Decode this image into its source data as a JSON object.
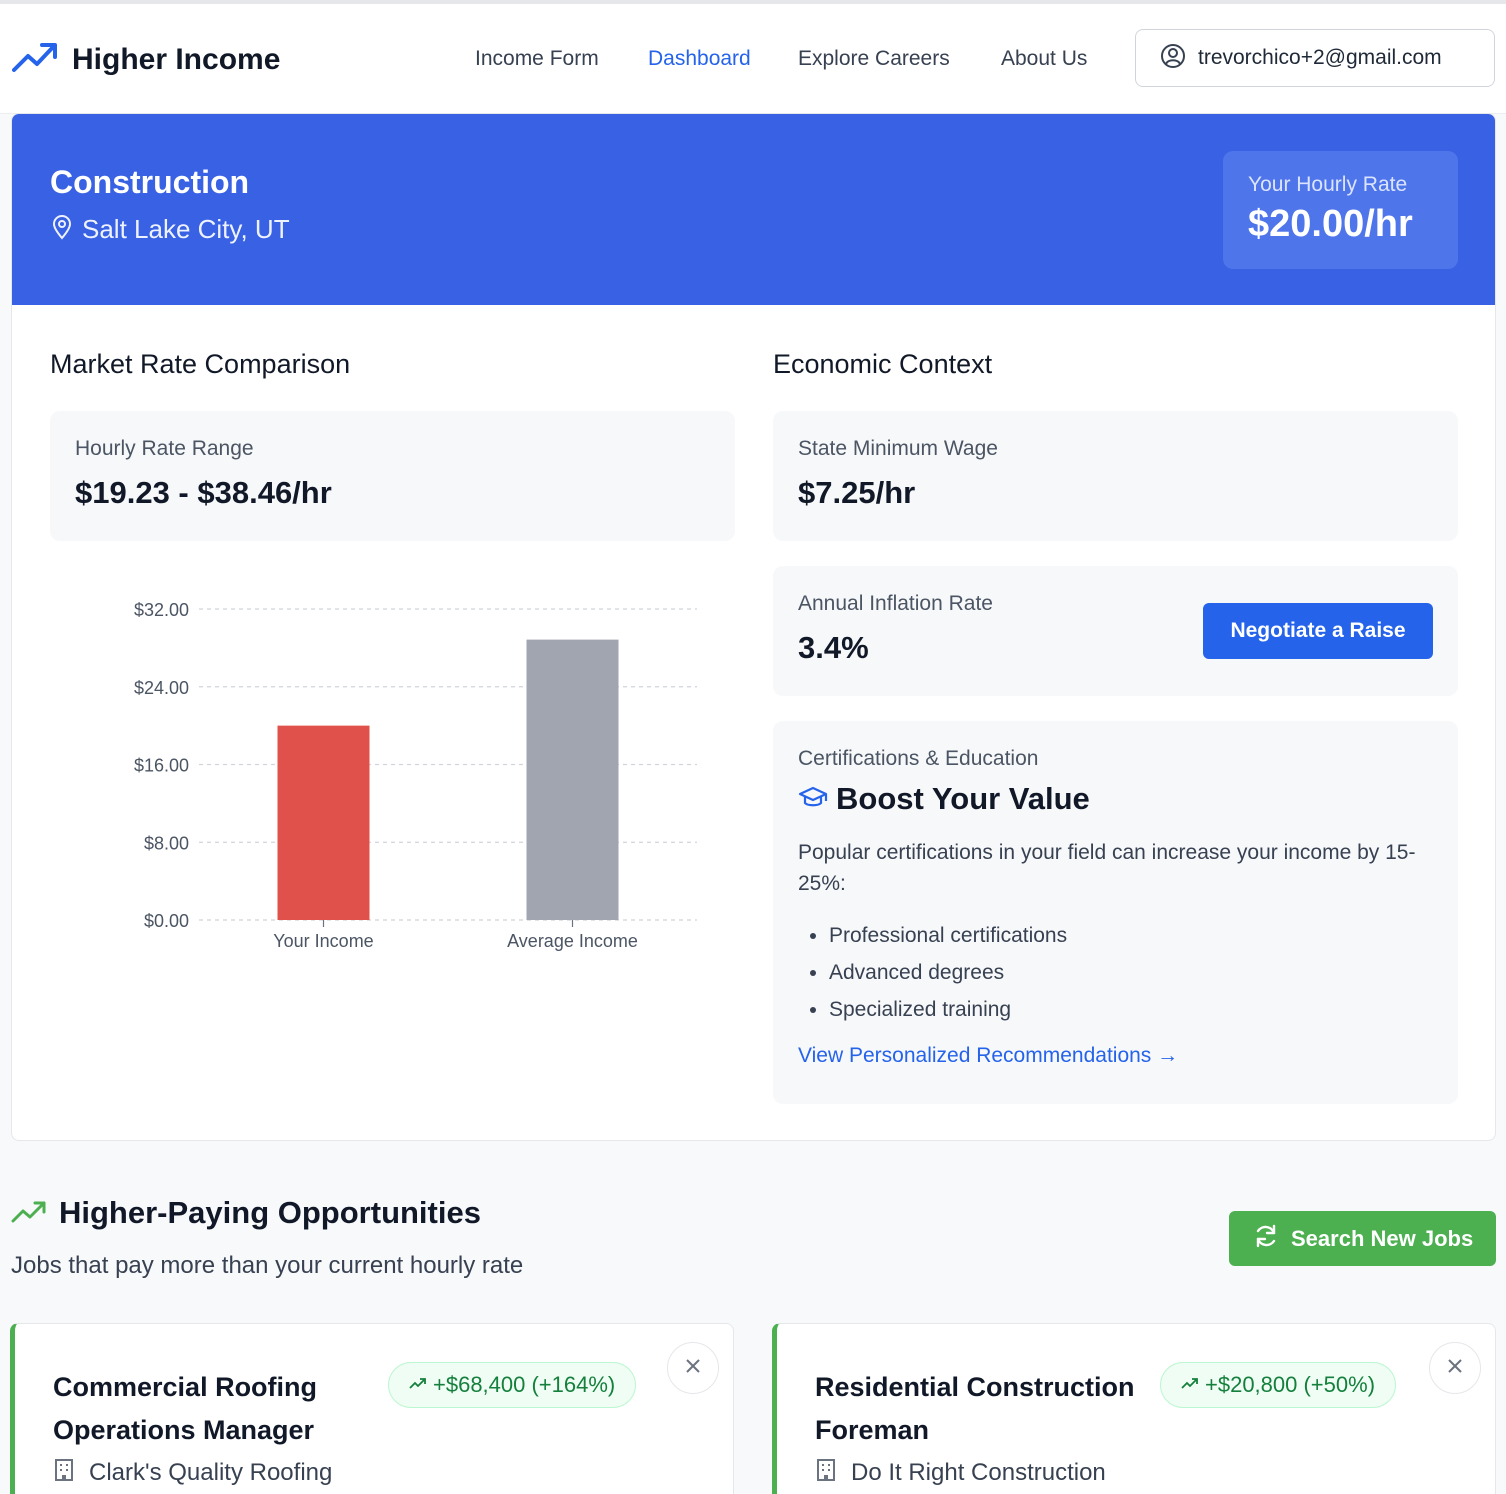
{
  "brand": {
    "name": "Higher Income",
    "icon": "trending-up-icon",
    "color": "#2563eb"
  },
  "nav": {
    "items": [
      {
        "label": "Income Form",
        "active": false
      },
      {
        "label": "Dashboard",
        "active": true
      },
      {
        "label": "Explore Careers",
        "active": false
      },
      {
        "label": "About Us",
        "active": false
      }
    ],
    "user_email": "trevorchico+2@gmail.com"
  },
  "banner": {
    "industry": "Construction",
    "location": "Salt Lake City, UT",
    "rate_label": "Your Hourly Rate",
    "rate_value": "$20.00/hr",
    "color": "#3861e3"
  },
  "market": {
    "title": "Market Rate Comparison",
    "range_label": "Hourly Rate Range",
    "range_value": "$19.23 - $38.46/hr"
  },
  "economic": {
    "title": "Economic Context",
    "min_wage_label": "State Minimum Wage",
    "min_wage_value": "$7.25/hr",
    "inflation_label": "Annual Inflation Rate",
    "inflation_value": "3.4%",
    "negotiate_label": "Negotiate a Raise"
  },
  "certifications": {
    "label": "Certifications & Education",
    "title": "Boost Your Value",
    "description": "Popular certifications in your field can increase your income by 15-25%:",
    "items": [
      "Professional certifications",
      "Advanced degrees",
      "Specialized training"
    ],
    "link": "View Personalized Recommendations →"
  },
  "chart_data": {
    "type": "bar",
    "categories": [
      "Your Income",
      "Average Income"
    ],
    "values": [
      20.0,
      28.85
    ],
    "colors": [
      "#e0514b",
      "#a1a5b0"
    ],
    "ylim": [
      0,
      32
    ],
    "yticks": [
      "$0.00",
      "$8.00",
      "$16.00",
      "$24.00",
      "$32.00"
    ],
    "ytick_values": [
      0,
      8,
      16,
      24,
      32
    ],
    "grid": true,
    "title": "",
    "xlabel": "",
    "ylabel": ""
  },
  "opportunities": {
    "title": "Higher-Paying Opportunities",
    "subtitle": "Jobs that pay more than your current hourly rate",
    "search_label": "Search New Jobs",
    "accent": "#4caf50",
    "jobs": [
      {
        "title": "Commercial Roofing Operations Manager",
        "increase": "+$68,400 (+164%)",
        "company": "Clark's Quality Roofing"
      },
      {
        "title": "Residential Construction Foreman",
        "increase": "+$20,800 (+50%)",
        "company": "Do It Right Construction"
      }
    ]
  }
}
